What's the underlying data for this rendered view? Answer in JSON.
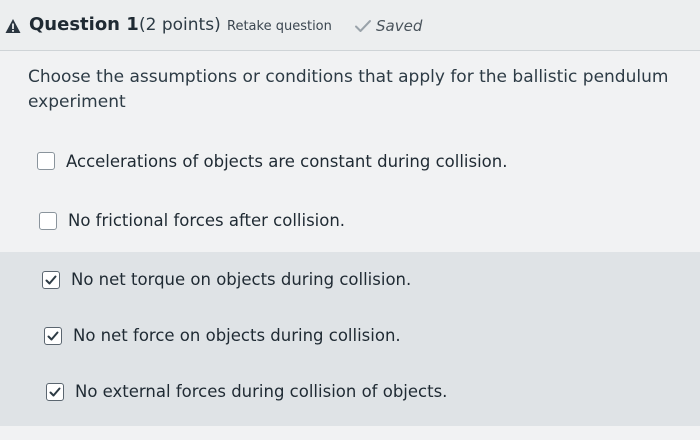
{
  "question": {
    "title": "Question 1",
    "points": "(2 points)",
    "retake_label": "Retake question",
    "saved_label": "Saved",
    "prompt": "Choose the assumptions or conditions that apply for the ballistic pendulum experiment"
  },
  "answers": [
    {
      "label": "Accelerations of objects are constant during collision.",
      "checked": false
    },
    {
      "label": "No frictional forces after collision.",
      "checked": false
    },
    {
      "label": "No net torque on objects during collision.",
      "checked": true
    },
    {
      "label": "No net force on objects during collision.",
      "checked": true
    },
    {
      "label": "No external forces during collision of objects.",
      "checked": true
    }
  ],
  "icons": {
    "warning": "warning-icon",
    "saved": "checkmark-icon",
    "checkbox_checked": "checkmark-icon"
  },
  "colors": {
    "selected_row_bg": "#dfe3e6",
    "text": "#2d3b45"
  }
}
